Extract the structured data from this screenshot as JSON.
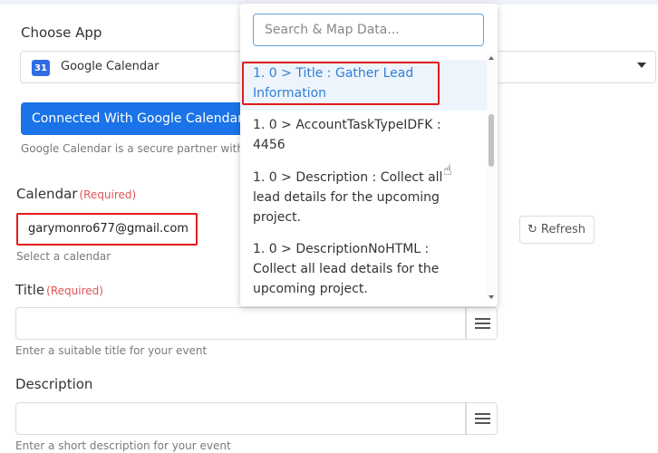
{
  "choose_app": {
    "label": "Choose App",
    "selected_app": "Google Calendar",
    "app_icon_text": "31",
    "app_icon": "google-calendar-icon"
  },
  "connection": {
    "button_label": "Connected With Google Calendar",
    "note": "Google Calendar is a secure partner with Pa"
  },
  "calendar": {
    "label": "Calendar",
    "required": "(Required)",
    "value": "garymonro677@gmail.com",
    "help": "Select a calendar",
    "refresh_label": "Refresh"
  },
  "title_field": {
    "label": "Title",
    "required": "(Required)",
    "help": "Enter a suitable title for your event"
  },
  "description_field": {
    "label": "Description",
    "help": "Enter a short description for your event"
  },
  "dropdown": {
    "search_placeholder": "Search & Map Data...",
    "options": [
      {
        "line1": "1. 0 > Title : Gather Lead",
        "line2": "Information"
      },
      {
        "line1": "1. 0 > AccountTaskTypeIDFK :",
        "line2": "4456"
      },
      {
        "line1": "1. 0 > Description : Collect all",
        "line2": "lead details for the upcoming",
        "line3": "project."
      },
      {
        "line1": "1. 0 > DescriptionNoHTML :",
        "line2": "Collect all lead details for the",
        "line3": "upcoming project."
      }
    ]
  },
  "colors": {
    "primary": "#1a73e8",
    "required": "#e05555",
    "highlight_outline": "#e21b1b",
    "selected_option": "#2f7fd6"
  }
}
